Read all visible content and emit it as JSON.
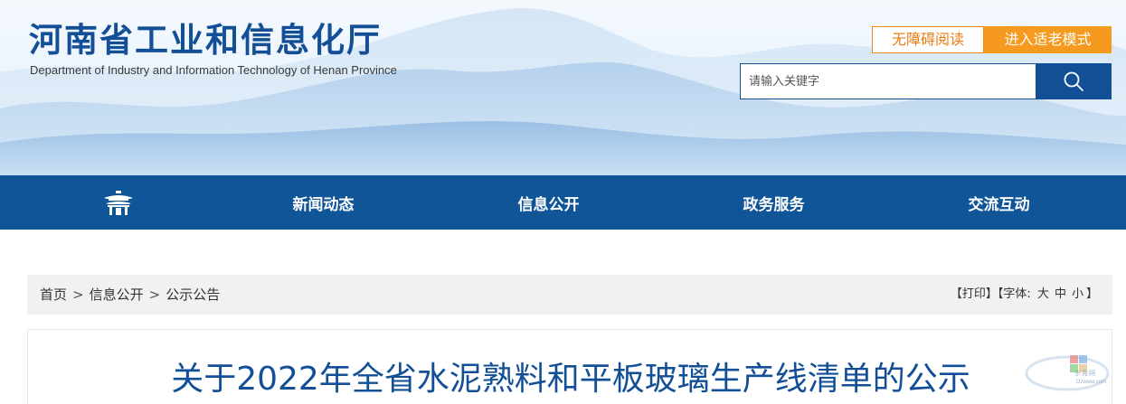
{
  "header": {
    "title": "河南省工业和信息化厅",
    "subtitle": "Department of Industry and Information Technology of Henan Province",
    "accessible_label": "无障碍阅读",
    "elder_mode_label": "进入适老模式",
    "search": {
      "placeholder": "请输入关键字",
      "icon": "search-icon"
    },
    "colors": {
      "brand_blue": "#134f96",
      "accent_orange": "#f59a1e"
    }
  },
  "nav": {
    "home_icon": "pavilion-home-icon",
    "items": [
      "新闻动态",
      "信息公开",
      "政务服务",
      "交流互动"
    ],
    "color": "#0f5598"
  },
  "breadcrumb": {
    "items": [
      "首页",
      "信息公开",
      "公示公告"
    ],
    "separator": ">"
  },
  "tools": {
    "print_label": "【打印】",
    "font_label": "【字体:",
    "sizes": [
      "大",
      "中",
      "小"
    ],
    "font_close": "】"
  },
  "article": {
    "title": "关于2022年全省水泥熟料和平板玻璃生产线清单的公示"
  },
  "watermark": {
    "text": "东莞网",
    "domain": "Dzwww.com"
  }
}
